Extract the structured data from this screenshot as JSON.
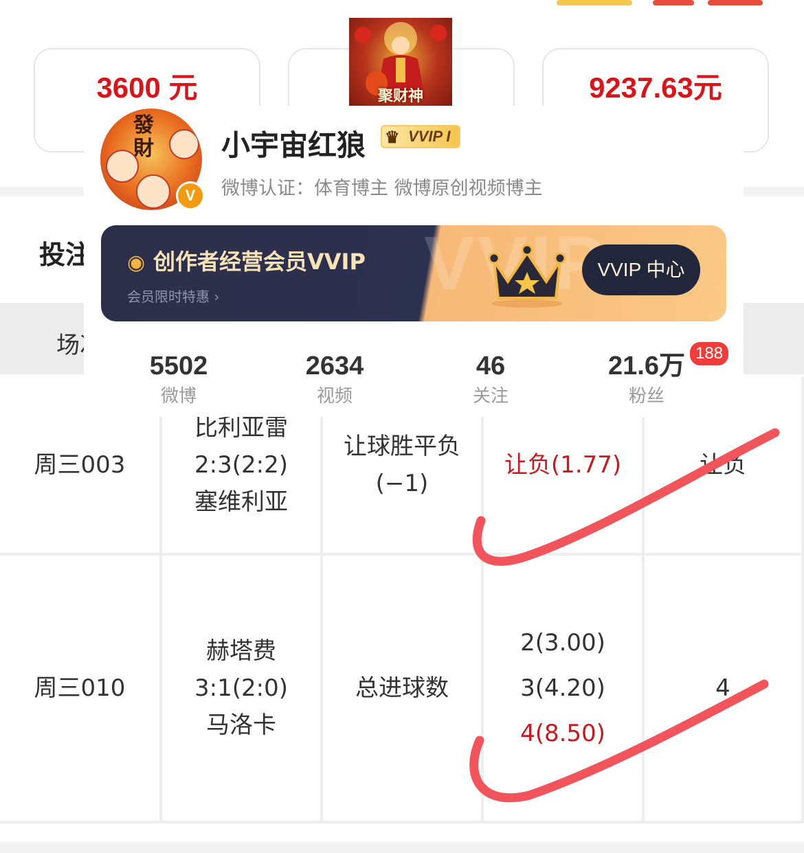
{
  "stats_cards": [
    {
      "amount": "3600 元"
    },
    {
      "amount": ""
    },
    {
      "amount": "9237.63元"
    }
  ],
  "banner": {
    "caption": "聚财神"
  },
  "section": {
    "title": "投注"
  },
  "table": {
    "headers": [
      "场次"
    ],
    "rows": [
      {
        "match_no": "周三003",
        "match_lines": [
          "比利亚雷",
          "2:3(2:2)",
          "塞维利亚"
        ],
        "play_lines": [
          "让球胜平负",
          "(−1)"
        ],
        "pick_lines": [
          "让负(1.77)"
        ],
        "result": "让负"
      },
      {
        "match_no": "周三010",
        "match_lines": [
          "赫塔费",
          "3:1(2:0)",
          "马洛卡"
        ],
        "play_lines": [
          "总进球数"
        ],
        "pick_lines": [
          "2(3.00)",
          "3(4.20)",
          "4(8.50)"
        ],
        "result": "4"
      }
    ]
  },
  "profile": {
    "avatar_text": "發財",
    "verified_mark": "V",
    "username": "小宇宙红狼",
    "vvip_badge": "VVIP I",
    "certification": "微博认证：体育博主 微博原创视频博主",
    "vip_banner": {
      "title": "创作者经营会员VVIP",
      "subtitle": "会员限时特惠 ›",
      "watermark": "VVIP",
      "button": "VVIP 中心"
    },
    "stats": [
      {
        "value": "5502",
        "label": "微博"
      },
      {
        "value": "2634",
        "label": "视频"
      },
      {
        "value": "46",
        "label": "关注"
      },
      {
        "value": "21.6万",
        "label": "粉丝"
      }
    ],
    "notification_count": "188"
  },
  "colors": {
    "amount_red": "#d9141b",
    "pick_red": "#c8191e",
    "check_mark": "#f2545b",
    "vip_dark": "#2b2f48",
    "vip_gold": "#fbc886"
  }
}
